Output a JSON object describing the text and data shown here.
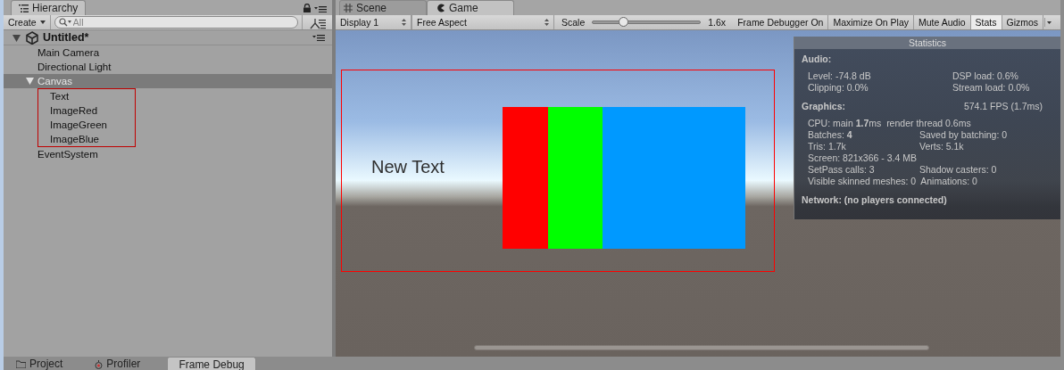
{
  "hierarchy": {
    "tab": {
      "label": "Hierarchy",
      "selected": true
    },
    "create_button": "Create",
    "search": {
      "placeholder": "All"
    },
    "scene": {
      "name": "Untitled*",
      "expanded": true,
      "children": [
        {
          "name": "Main Camera",
          "selected": false
        },
        {
          "name": "Directional Light",
          "selected": false
        },
        {
          "name": "Canvas",
          "selected": true,
          "expanded": true,
          "outlined": true,
          "children": [
            {
              "name": "Text",
              "selected": false
            },
            {
              "name": "ImageRed",
              "selected": false
            },
            {
              "name": "ImageGreen",
              "selected": false
            },
            {
              "name": "ImageBlue",
              "selected": false
            }
          ]
        },
        {
          "name": "EventSystem",
          "selected": false
        }
      ]
    }
  },
  "game_panel": {
    "tabs": [
      {
        "label": "Scene",
        "kind": "scene",
        "selected": false
      },
      {
        "label": "Game",
        "kind": "game",
        "selected": true
      }
    ],
    "toolbar": {
      "display": "Display 1",
      "aspect": "Free Aspect",
      "scale_label": "Scale",
      "scale_slider": {
        "level": 0.29
      },
      "scale_value": "1.6x",
      "toggles": [
        {
          "label": "Frame Debugger On",
          "on": false
        },
        {
          "label": "Maximize On Play",
          "on": false
        },
        {
          "label": "Mute Audio",
          "on": false
        },
        {
          "label": "Stats",
          "on": true
        },
        {
          "label": "Gizmos",
          "on": false
        }
      ]
    },
    "game_view": {
      "ui_text": "New Text",
      "images": [
        {
          "color": "#ff0000"
        },
        {
          "color": "#00ff00"
        },
        {
          "color": "#0099ff"
        }
      ]
    },
    "statistics": {
      "title": "Statistics",
      "audio": {
        "heading": "Audio:",
        "rows": [
          [
            "Level: -74.8 dB",
            "DSP load: 0.6%"
          ],
          [
            "Clipping: 0.0%",
            "Stream load: 0.0%"
          ]
        ]
      },
      "graphics": {
        "heading": "Graphics:",
        "fps": "574.1 FPS (1.7ms)",
        "rows": [
          [
            "CPU: main **1.7**ms  render thread 0.6ms"
          ],
          [
            "Batches: **4**",
            "Saved by batching: 0"
          ],
          [
            "Tris: 1.7k",
            "Verts: 5.1k"
          ],
          [
            "Screen: 821x366 - 3.4 MB"
          ],
          [
            "SetPass calls: 3",
            "Shadow casters: 0"
          ],
          [
            "Visible skinned meshes: 0",
            "Animations: 0"
          ]
        ]
      },
      "network": "Network: (no players connected)"
    }
  },
  "bottom_tabs": [
    {
      "label": "Project",
      "kind": "project",
      "selected": false
    },
    {
      "label": "Profiler",
      "kind": "profiler",
      "selected": false
    },
    {
      "label": "Frame Debug",
      "kind": "plain",
      "selected": true
    }
  ]
}
